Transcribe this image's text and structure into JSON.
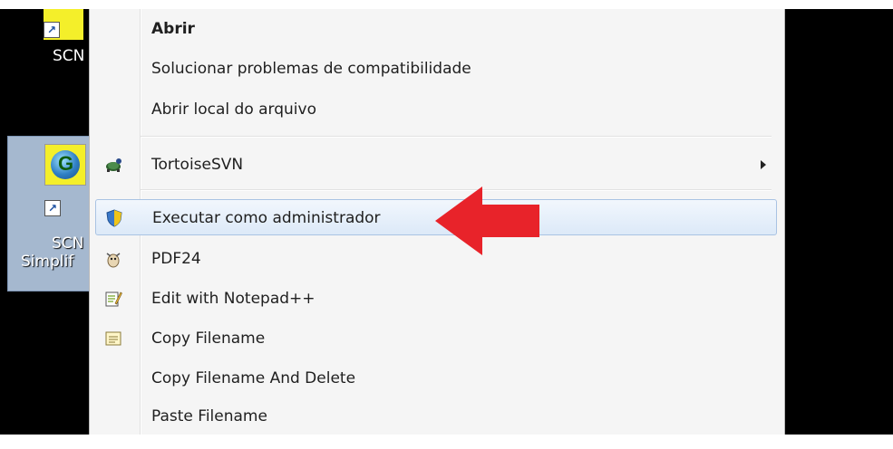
{
  "desktop": {
    "icon1_label": "SCN",
    "icon2_label_line1": "SCN",
    "icon2_label_line2": "Simplif"
  },
  "menu": {
    "open": "Abrir",
    "troubleshoot": "Solucionar problemas de compatibilidade",
    "open_location": "Abrir local do arquivo",
    "tortoise": "TortoiseSVN",
    "run_as_admin": "Executar como administrador",
    "pdf24": "PDF24",
    "notepadpp": "Edit with Notepad++",
    "copy_filename": "Copy Filename",
    "copy_filename_delete": "Copy Filename And Delete",
    "paste_filename": "Paste Filename"
  },
  "colors": {
    "highlight": "#dce9f8",
    "arrow": "#e8232a"
  },
  "icons": [
    "tortoisesvn-icon",
    "uac-shield-icon",
    "pdf24-icon",
    "notepadpp-icon",
    "copy-filename-icon",
    "submenu-arrow-icon"
  ]
}
